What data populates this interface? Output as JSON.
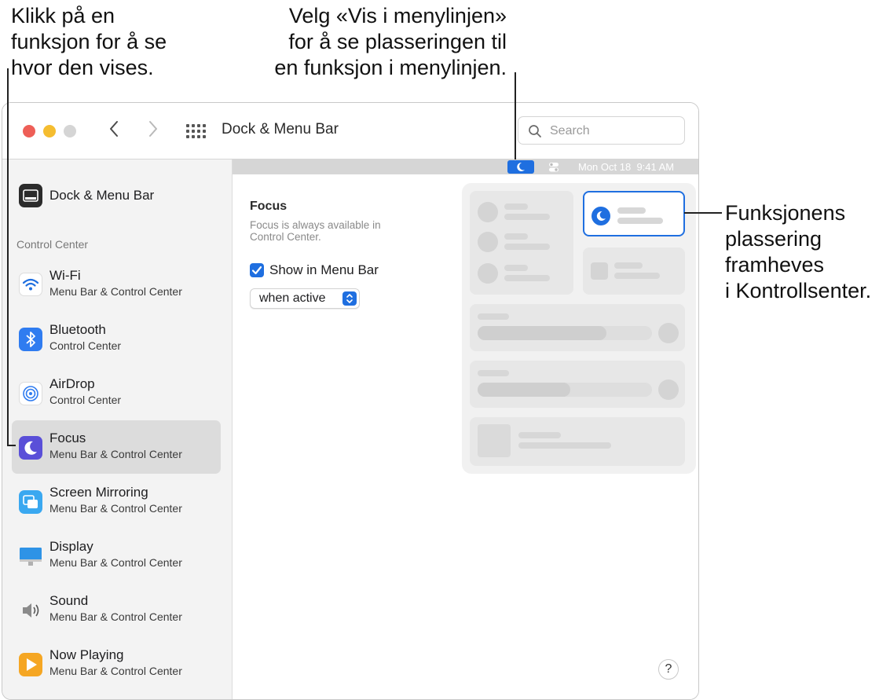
{
  "callouts": {
    "left": [
      "Klikk på en",
      "funksjon for å se",
      "hvor den vises."
    ],
    "top": [
      "Velg «Vis i menylinjen»",
      "for å se plasseringen til",
      "en funksjon i menylinjen."
    ],
    "right": [
      "Funksjonens",
      "plassering",
      "framheves",
      "i Kontrollsenter."
    ]
  },
  "window": {
    "title": "Dock & Menu Bar",
    "search_placeholder": "Search"
  },
  "sidebar": {
    "top_item": {
      "label": "Dock & Menu Bar",
      "icon": "dock-icon"
    },
    "section_header": "Control Center",
    "items": [
      {
        "label": "Wi-Fi",
        "sub": "Menu Bar & Control Center",
        "icon": "wifi-icon",
        "selected": false
      },
      {
        "label": "Bluetooth",
        "sub": "Control Center",
        "icon": "bluetooth-icon",
        "selected": false
      },
      {
        "label": "AirDrop",
        "sub": "Control Center",
        "icon": "airdrop-icon",
        "selected": false
      },
      {
        "label": "Focus",
        "sub": "Menu Bar & Control Center",
        "icon": "moon-icon",
        "selected": true
      },
      {
        "label": "Screen Mirroring",
        "sub": "Menu Bar & Control Center",
        "icon": "screen-mirroring-icon",
        "selected": false
      },
      {
        "label": "Display",
        "sub": "Menu Bar & Control Center",
        "icon": "display-icon",
        "selected": false
      },
      {
        "label": "Sound",
        "sub": "Menu Bar & Control Center",
        "icon": "speaker-icon",
        "selected": false
      },
      {
        "label": "Now Playing",
        "sub": "Menu Bar & Control Center",
        "icon": "play-icon",
        "selected": false
      }
    ]
  },
  "menubar": {
    "date": "Mon Oct 18",
    "time": "9:41 AM"
  },
  "focus_panel": {
    "title": "Focus",
    "description": "Focus is always available in Control Center.",
    "checkbox_label": "Show in Menu Bar",
    "checkbox_checked": true,
    "select_value": "when active"
  },
  "help_label": "?",
  "colors": {
    "accent": "#1f6fe0",
    "selected_row": "#dcdcdc",
    "sidebar_bg": "#f3f3f3"
  }
}
